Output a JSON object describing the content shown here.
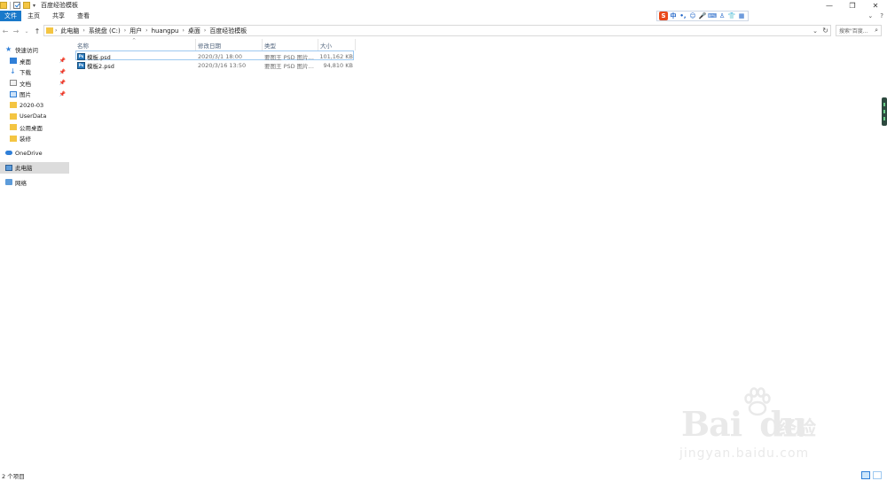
{
  "window": {
    "title": "百度经验模板",
    "buttons": {
      "minimize": "—",
      "restore": "❐",
      "close": "✕"
    }
  },
  "ribbon": {
    "tabs": [
      "文件",
      "主页",
      "共享",
      "查看"
    ],
    "collapse": "⌄",
    "help": "?"
  },
  "ime_toolbar": [
    "S",
    "中",
    "•,",
    "☺",
    "🎤",
    "⌨",
    "♙",
    "👕",
    "▦"
  ],
  "address": {
    "crumbs": [
      "此电脑",
      "系统盘 (C:)",
      "用户",
      "huangpu",
      "桌面",
      "百度经验模板"
    ],
    "search_placeholder": "搜索\"百度...",
    "refresh": "↻",
    "dropdown": "⌄"
  },
  "sidebar": {
    "quick_access": "快速访问",
    "items": [
      {
        "label": "桌面",
        "icon": "desktop-icon",
        "pinned": true
      },
      {
        "label": "下载",
        "icon": "download-icon",
        "pinned": true
      },
      {
        "label": "文档",
        "icon": "documents-icon",
        "pinned": true
      },
      {
        "label": "图片",
        "icon": "pictures-icon",
        "pinned": true
      },
      {
        "label": "2020-03",
        "icon": "folder-icon",
        "pinned": false
      },
      {
        "label": "UserData",
        "icon": "folder-icon",
        "pinned": false
      },
      {
        "label": "公用桌面",
        "icon": "folder-icon",
        "pinned": false
      },
      {
        "label": "装修",
        "icon": "folder-icon",
        "pinned": false
      }
    ],
    "onedrive": "OneDrive",
    "this_pc": "此电脑",
    "network": "网络"
  },
  "file_list": {
    "columns": [
      "名称",
      "修改日期",
      "类型",
      "大小"
    ],
    "rows": [
      {
        "name": "模板.psd",
        "date": "2020/3/1 18:00",
        "type": "要图王 PSD 图片...",
        "size": "101,162 KB",
        "selected": true
      },
      {
        "name": "模板2.psd",
        "date": "2020/3/16 13:50",
        "type": "要图王 PSD 图片...",
        "size": "94,810 KB",
        "selected": false
      }
    ]
  },
  "status": {
    "count": "2 个项目"
  },
  "watermark": {
    "brand": "Bai",
    "brand2": "du",
    "suffix": "经验",
    "url": "jingyan.baidu.com"
  }
}
